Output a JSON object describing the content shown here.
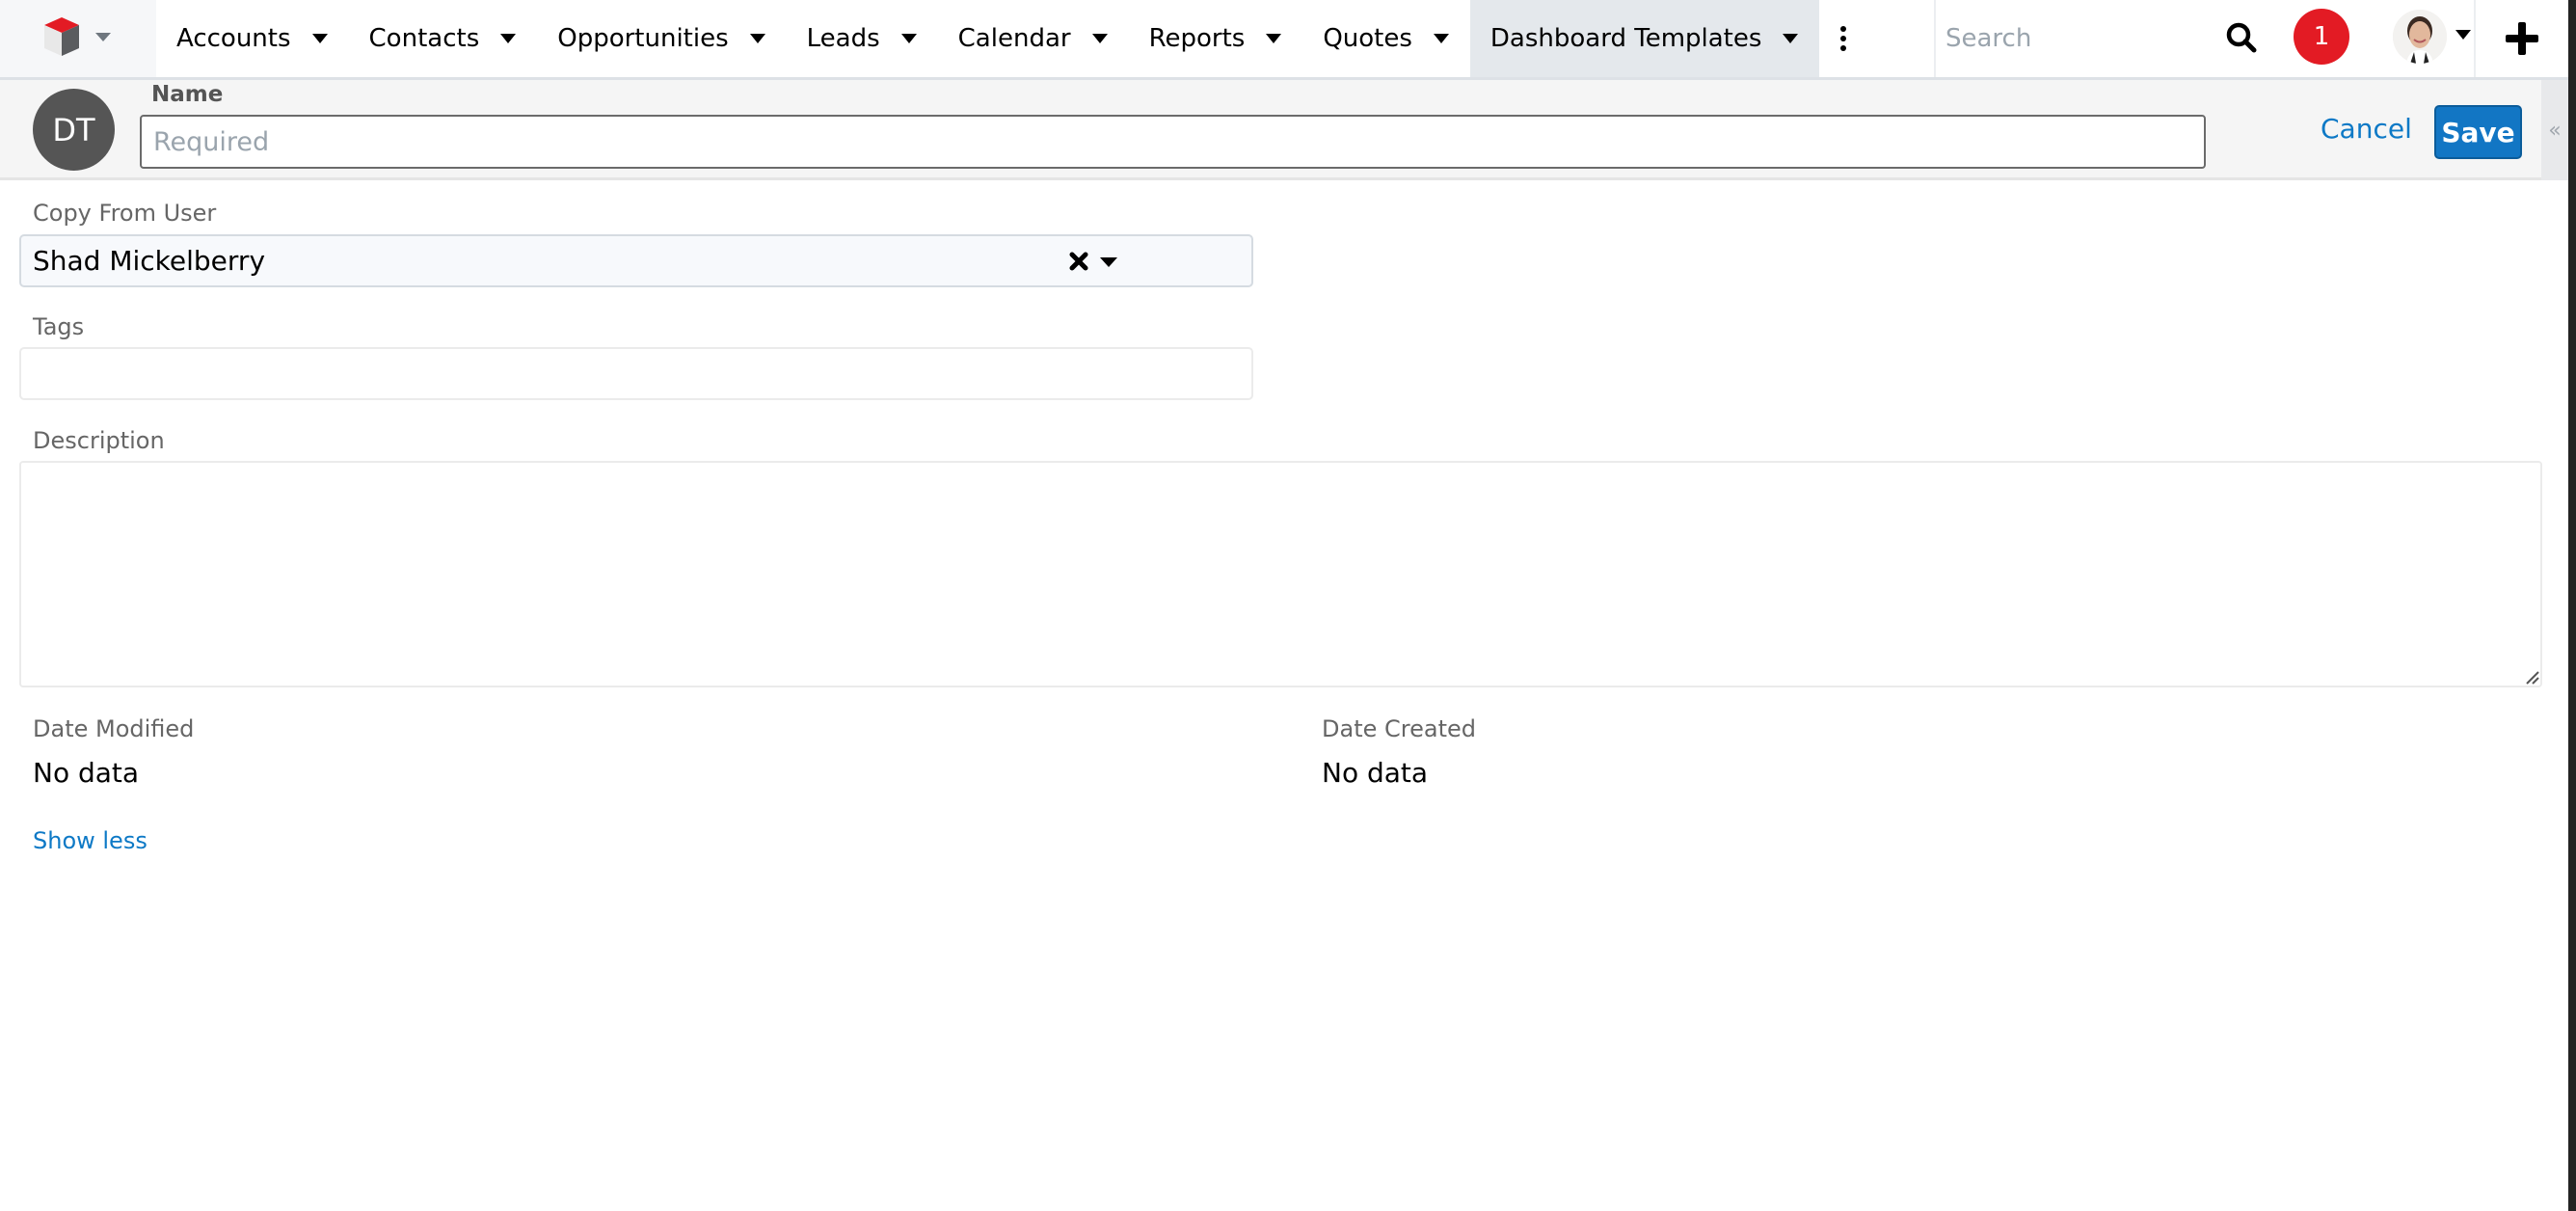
{
  "nav": {
    "logo": "sugarcrm-cube-logo",
    "tabs": [
      {
        "label": "Accounts",
        "active": false
      },
      {
        "label": "Contacts",
        "active": false
      },
      {
        "label": "Opportunities",
        "active": false
      },
      {
        "label": "Leads",
        "active": false
      },
      {
        "label": "Calendar",
        "active": false
      },
      {
        "label": "Reports",
        "active": false
      },
      {
        "label": "Quotes",
        "active": false
      },
      {
        "label": "Dashboard Templates",
        "active": true
      }
    ],
    "search_placeholder": "Search",
    "notification_count": "1",
    "colors": {
      "notification": "#e31b24",
      "active_tab_bg": "#e4e8ec"
    }
  },
  "record": {
    "avatar_initials": "DT",
    "name_label": "Name",
    "name_value": "",
    "name_placeholder": "Required",
    "cancel_label": "Cancel",
    "save_label": "Save",
    "collapse_icon": "«",
    "colors": {
      "primary": "#1276c4",
      "link": "#0d79c6"
    }
  },
  "form": {
    "copy_from_user": {
      "label": "Copy From User",
      "value": "Shad Mickelberry"
    },
    "tags": {
      "label": "Tags",
      "value": ""
    },
    "description": {
      "label": "Description",
      "value": ""
    },
    "date_modified": {
      "label": "Date Modified",
      "value": "No data"
    },
    "date_created": {
      "label": "Date Created",
      "value": "No data"
    },
    "show_less_label": "Show less"
  }
}
